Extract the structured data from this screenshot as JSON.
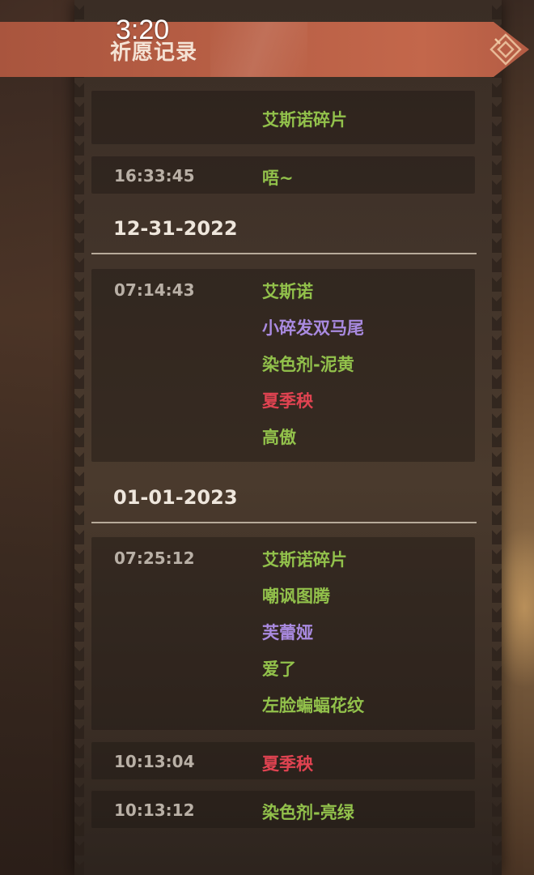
{
  "status_bar": {
    "time": "3:20"
  },
  "header": {
    "title": "祈愿记录"
  },
  "colors": {
    "green": "#92c14b",
    "purple": "#a98ae0",
    "red": "#e04351",
    "ribbon": "#b85f45"
  },
  "records": [
    {
      "time": "",
      "items": [
        {
          "name": "艾斯诺碎片",
          "color": "green"
        }
      ]
    },
    {
      "time": "16:33:45",
      "items": [
        {
          "name": "唔~",
          "color": "green"
        }
      ]
    }
  ],
  "date_groups": [
    {
      "date": "12-31-2022",
      "entries": [
        {
          "time": "07:14:43",
          "items": [
            {
              "name": "艾斯诺",
              "color": "green"
            },
            {
              "name": "小碎发双马尾",
              "color": "purple"
            },
            {
              "name": "染色剂-泥黄",
              "color": "green"
            },
            {
              "name": "夏季秧",
              "color": "red"
            },
            {
              "name": "高傲",
              "color": "green"
            }
          ]
        }
      ]
    },
    {
      "date": "01-01-2023",
      "entries": [
        {
          "time": "07:25:12",
          "items": [
            {
              "name": "艾斯诺碎片",
              "color": "green"
            },
            {
              "name": "嘲讽图腾",
              "color": "green"
            },
            {
              "name": "芙蕾娅",
              "color": "purple"
            },
            {
              "name": "爱了",
              "color": "green"
            },
            {
              "name": "左脸蝙蝠花纹",
              "color": "green"
            }
          ]
        },
        {
          "time": "10:13:04",
          "items": [
            {
              "name": "夏季秧",
              "color": "red"
            }
          ]
        },
        {
          "time": "10:13:12",
          "items": [
            {
              "name": "染色剂-亮绿",
              "color": "green"
            }
          ]
        }
      ]
    }
  ]
}
